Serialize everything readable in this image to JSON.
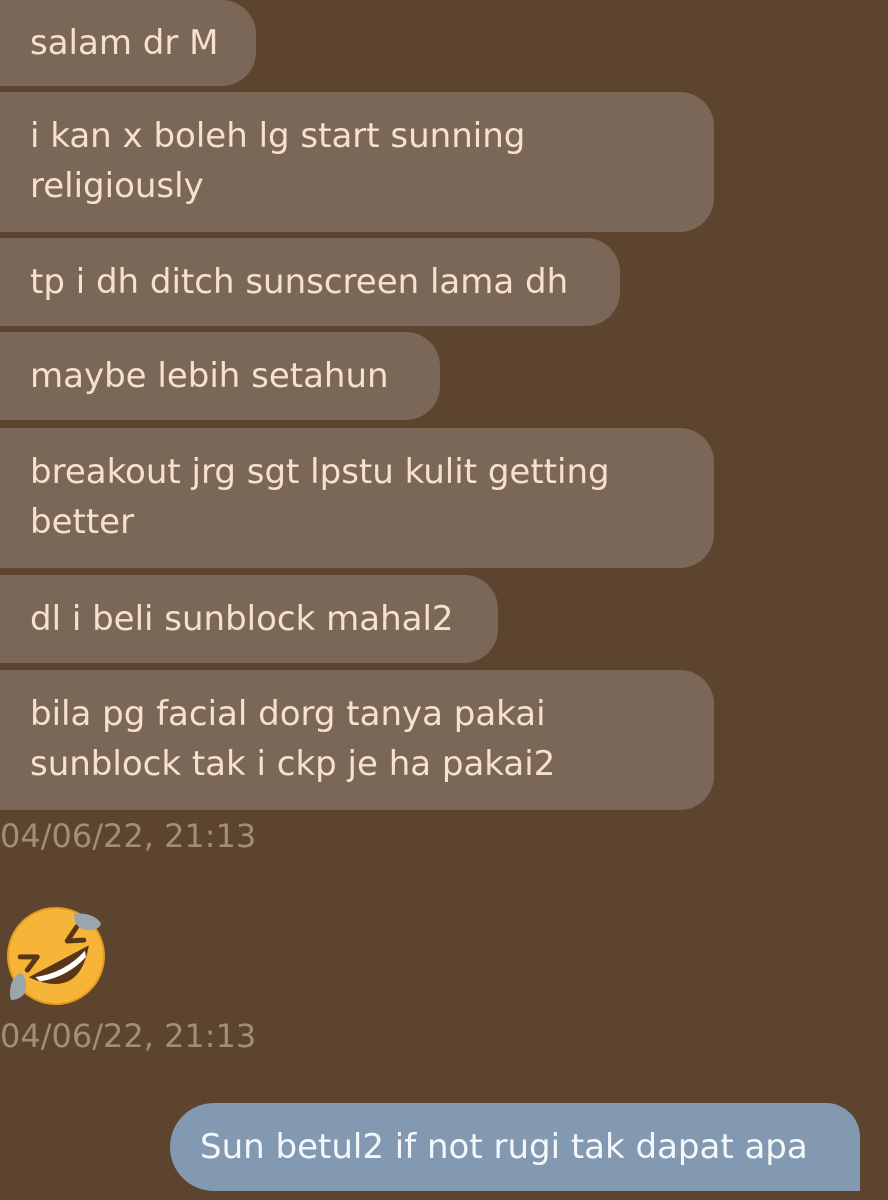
{
  "conversation": {
    "incoming_messages": [
      {
        "text": "salam dr M"
      },
      {
        "text": "i kan x boleh lg start sunning religiously"
      },
      {
        "text": "tp i dh ditch sunscreen lama dh"
      },
      {
        "text": "maybe lebih setahun"
      },
      {
        "text": "breakout jrg sgt lpstu kulit getting better"
      },
      {
        "text": "dl i beli sunblock mahal2"
      },
      {
        "text": "bila pg facial dorg tanya pakai sunblock tak i ckp je ha pakai2"
      }
    ],
    "timestamp_1": "04/06/22, 21:13",
    "emoji_message": {
      "icon": "rolling-on-the-floor-laughing-emoji"
    },
    "timestamp_2": "04/06/22, 21:13",
    "outgoing_message": {
      "text": "Sun betul2 if not rugi tak dapat apa"
    }
  },
  "colors": {
    "background": "#5c442e",
    "incoming_bubble": "#7a6757",
    "incoming_text": "#f6e2c9",
    "outgoing_bubble": "#8299b1",
    "outgoing_text": "#f5f8fb",
    "timestamp": "#a18e79"
  }
}
